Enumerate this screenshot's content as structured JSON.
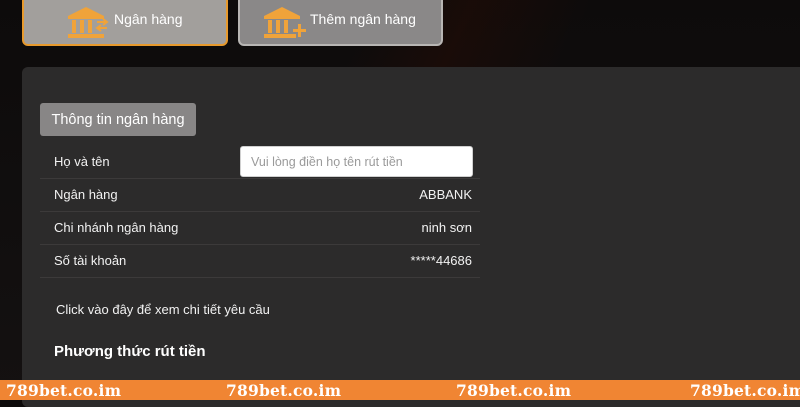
{
  "top_buttons": {
    "bank_label": "Ngân hàng",
    "add_bank_label": "Thêm ngân hàng"
  },
  "section": {
    "title": "Thông tin ngân hàng"
  },
  "form": {
    "full_name_label": "Họ và tên",
    "full_name_placeholder": "Vui lòng điền họ tên rút tiền",
    "full_name_value": "",
    "bank_label": "Ngân hàng",
    "bank_value": "ABBANK",
    "branch_label": "Chi nhánh ngân hàng",
    "branch_value": "ninh sơn",
    "account_label": "Số tài khoản",
    "account_value": "*****44686"
  },
  "detail_link": "Click vào đây để xem chi tiết yêu cầu",
  "withdraw_method_title": "Phương thức rút tiền",
  "watermark": "789bet.co.im",
  "icons": {
    "bank": "bank-building-icon",
    "add_bank": "bank-add-icon"
  },
  "colors": {
    "accent_orange": "#f08533",
    "active_border": "#e79a2e",
    "panel": "#2c2b2b",
    "background": "#0c0a0a",
    "icon_orange": "#f0a33a"
  }
}
